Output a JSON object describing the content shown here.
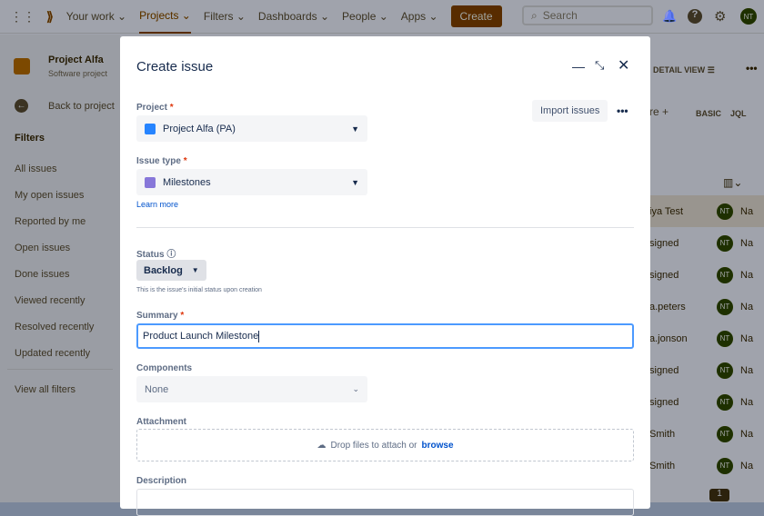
{
  "nav": {
    "items": [
      "Your work",
      "Projects",
      "Filters",
      "Dashboards",
      "People",
      "Apps"
    ],
    "create": "Create",
    "search_placeholder": "Search",
    "avatar": "NT"
  },
  "sidebar": {
    "project_name": "Project Alfa",
    "project_type": "Software project",
    "back": "Back to project",
    "filters_heading": "Filters",
    "items": [
      "All issues",
      "My open issues",
      "Reported by me",
      "Open issues",
      "Done issues",
      "Viewed recently",
      "Resolved recently",
      "Updated recently"
    ],
    "view_all": "View all filters"
  },
  "right": {
    "detail_view": "DETAIL VIEW",
    "more_label": "re",
    "basic": "BASIC",
    "jql": "JQL",
    "rows": [
      {
        "name": "iya Test"
      },
      {
        "name": "signed"
      },
      {
        "name": "signed"
      },
      {
        "name": "a.peters"
      },
      {
        "name": "a.jonson"
      },
      {
        "name": "signed"
      },
      {
        "name": "signed"
      },
      {
        "name": "Smith"
      },
      {
        "name": "Smith"
      }
    ],
    "avatar": "NT",
    "reporter": "Na",
    "page": "1"
  },
  "modal": {
    "title": "Create issue",
    "import": "Import issues",
    "project_label": "Project",
    "project_value": "Project Alfa (PA)",
    "issue_type_label": "Issue type",
    "issue_type_value": "Milestones",
    "learn_more": "Learn more",
    "status_label": "Status",
    "status_value": "Backlog",
    "status_help": "This is the issue's initial status upon creation",
    "summary_label": "Summary",
    "summary_value": "Product Launch Milestone",
    "components_label": "Components",
    "components_value": "None",
    "attachment_label": "Attachment",
    "drop_text": "Drop files to attach or",
    "browse": "browse",
    "description_label": "Description"
  }
}
